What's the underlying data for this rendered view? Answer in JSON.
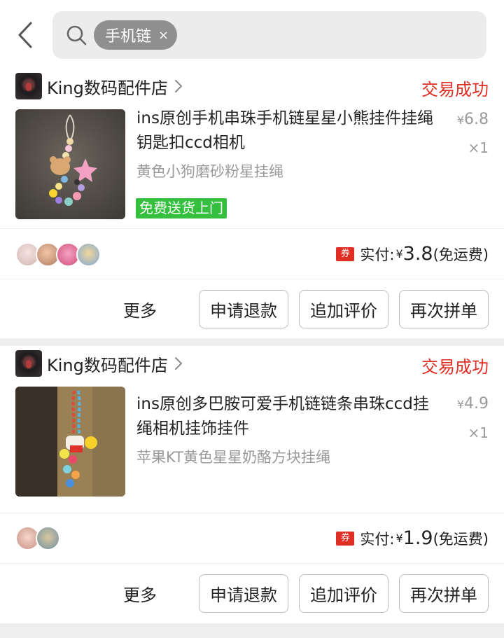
{
  "header": {
    "back_icon": "chevron-left-icon",
    "search_icon": "search-icon",
    "search_chip": "手机链",
    "chip_close": "×"
  },
  "orders": [
    {
      "shop_name": "King数码配件店",
      "status": "交易成功",
      "title": "ins原创手机串珠手机链星星小熊挂件挂绳钥匙扣ccd相机",
      "price_symbol": "¥",
      "price": "6.8",
      "quantity": "×1",
      "variant": "黄色小狗磨砂粉星挂绳",
      "tag": "免费送货上门",
      "coupon": "券",
      "paid_label": "实付:",
      "paid_symbol": "¥",
      "paid_amount": "3.8",
      "shipping": "(免运费)",
      "avatar_count": 4,
      "more_label": "更多",
      "buttons": [
        "申请退款",
        "追加评价",
        "再次拼单"
      ]
    },
    {
      "shop_name": "King数码配件店",
      "status": "交易成功",
      "title": "ins原创多巴胺可爱手机链链条串珠ccd挂绳相机挂饰挂件",
      "price_symbol": "¥",
      "price": "4.9",
      "quantity": "×1",
      "variant": "苹果KT黄色星星奶酪方块挂绳",
      "coupon": "券",
      "paid_label": "实付:",
      "paid_symbol": "¥",
      "paid_amount": "1.9",
      "shipping": "(免运费)",
      "avatar_count": 2,
      "more_label": "更多",
      "buttons": [
        "申请退款",
        "追加评价",
        "再次拼单"
      ]
    }
  ],
  "colors": {
    "accent_red": "#e02e24",
    "tag_green": "#34c03e",
    "muted_text": "#9a9a9a"
  }
}
